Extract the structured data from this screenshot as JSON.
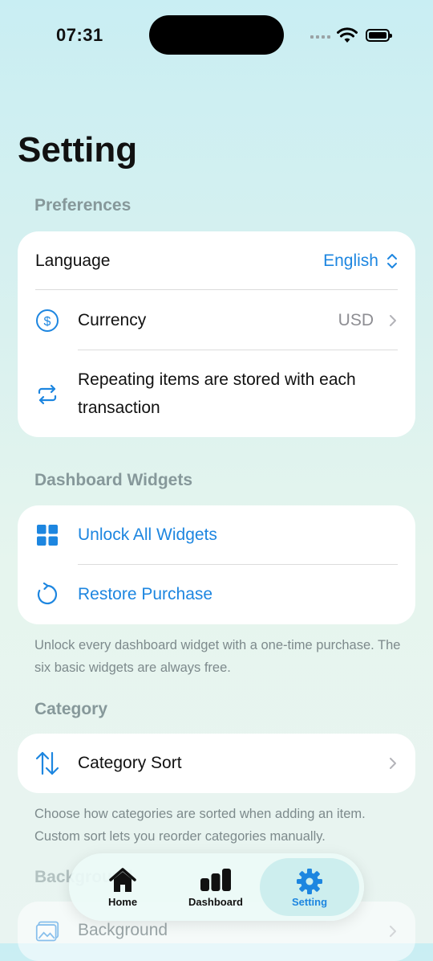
{
  "status_bar": {
    "time": "07:31"
  },
  "page": {
    "title": "Setting"
  },
  "preferences": {
    "title": "Preferences",
    "language_label": "Language",
    "language_value": "English",
    "currency_label": "Currency",
    "currency_value": "USD",
    "repeating_label": "Repeating items are stored with each transaction"
  },
  "widgets": {
    "title": "Dashboard Widgets",
    "unlock_label": "Unlock All Widgets",
    "restore_label": "Restore Purchase",
    "footnote": "Unlock every dashboard widget with a one-time purchase. The six basic widgets are always free."
  },
  "category": {
    "title": "Category",
    "sort_label": "Category Sort",
    "footnote": "Choose how categories are sorted when adding an item. Custom sort lets you reorder categories manually."
  },
  "background": {
    "title": "Background",
    "item_label": "Background"
  },
  "tabbar": {
    "tabs": [
      {
        "label": "Home",
        "icon": "house-icon"
      },
      {
        "label": "Dashboard",
        "icon": "bar-chart-icon"
      },
      {
        "label": "Setting",
        "icon": "gear-icon"
      }
    ],
    "active": "Setting"
  },
  "colors": {
    "accent": "#1d86e0",
    "section": "#86989a"
  }
}
